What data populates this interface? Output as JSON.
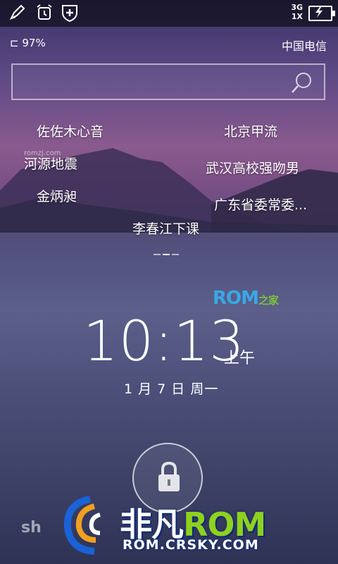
{
  "status_bar": {
    "network_top": "3G",
    "network_bottom": "1X",
    "icons": [
      "pencil-icon",
      "alarm-icon",
      "shield-plus-icon",
      "battery-charging-icon"
    ]
  },
  "info_row": {
    "battery_percent": "97%",
    "carrier": "中国电信"
  },
  "search": {
    "placeholder": ""
  },
  "hot_topics": [
    "佐佐木心音",
    "北京甲流",
    "河源地震",
    "武汉高校强吻男",
    "金炳昶",
    "广东省委常委...",
    "李春江下课"
  ],
  "watermark_small": "romzj.com",
  "brand_logo": {
    "main": "ROM",
    "sub": "之家"
  },
  "clock": {
    "time": "10:13",
    "ampm": "上午",
    "date": "1 月 7 日 周一"
  },
  "bottom_watermark": {
    "left_text": "sh",
    "brand_a": "非凡",
    "brand_b": "ROM",
    "url": "ROM.CRSKY.COM"
  },
  "colors": {
    "accent_blue": "#3aa8e6",
    "accent_green": "#8fd11d"
  }
}
